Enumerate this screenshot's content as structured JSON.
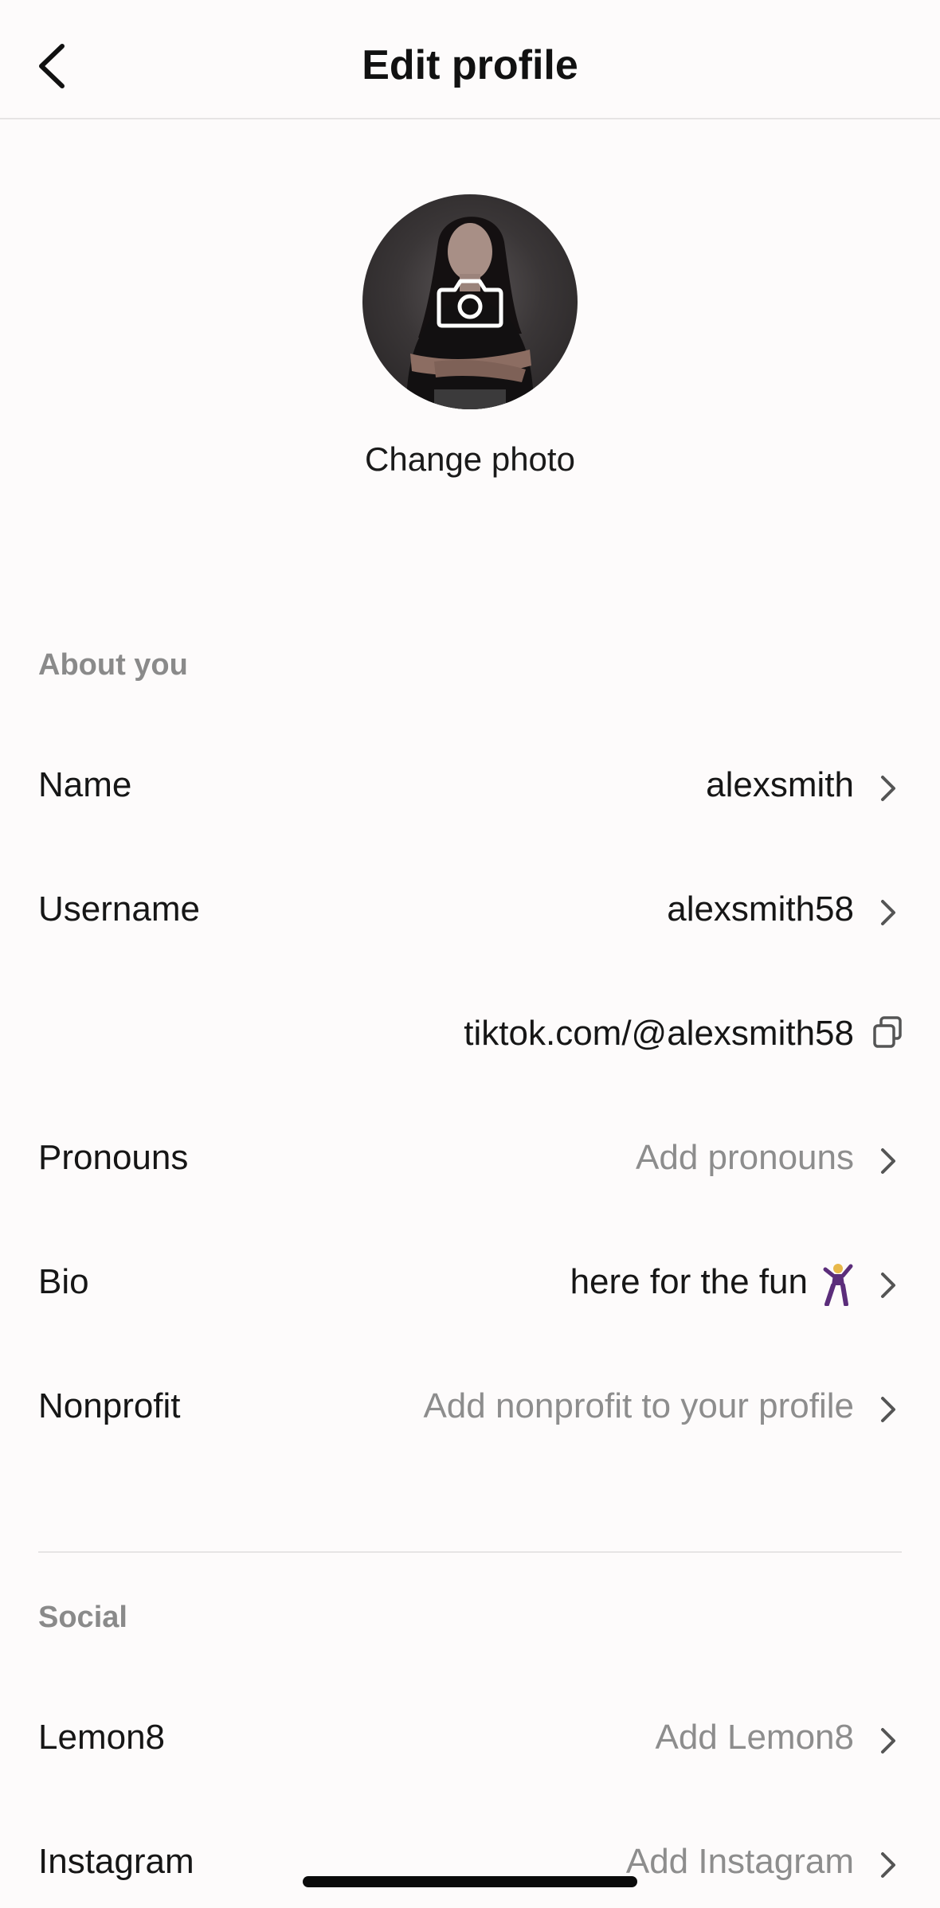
{
  "header": {
    "title": "Edit profile"
  },
  "profile_photo": {
    "change_label": "Change photo"
  },
  "about": {
    "section_title": "About you",
    "name": {
      "label": "Name",
      "value": "alexsmith"
    },
    "username": {
      "label": "Username",
      "value": "alexsmith58"
    },
    "profile_link": {
      "value": "tiktok.com/@alexsmith58"
    },
    "pronouns": {
      "label": "Pronouns",
      "value": "Add pronouns"
    },
    "bio": {
      "label": "Bio",
      "value": "here for the fun"
    },
    "nonprofit": {
      "label": "Nonprofit",
      "value": "Add nonprofit to your profile"
    }
  },
  "social": {
    "section_title": "Social",
    "lemon8": {
      "label": "Lemon8",
      "value": "Add Lemon8"
    },
    "instagram": {
      "label": "Instagram",
      "value": "Add Instagram"
    }
  },
  "icons": {
    "back": "chevron-left-icon",
    "camera": "camera-icon",
    "chevron": "chevron-right-icon",
    "copy": "copy-icon",
    "bio_emoji": "dancing-figure-emoji"
  },
  "colors": {
    "background": "#fdfbfb",
    "text": "#161616",
    "muted": "#8d8d8d",
    "section_header": "#8a8a8a",
    "divider": "#e6e4e4"
  }
}
